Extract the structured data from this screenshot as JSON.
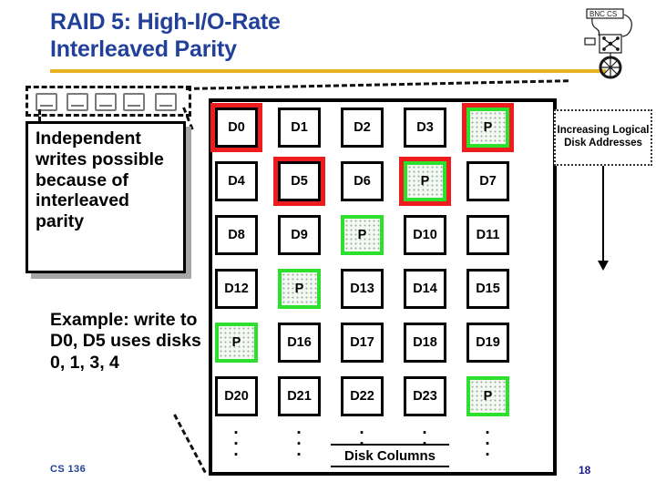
{
  "slide": {
    "title_line1": "RAID 5: High-I/O-Rate",
    "title_line2": "Interleaved Parity",
    "course": "CS 136",
    "page_number": "18",
    "title_color": "#21409A",
    "rule_color": "#E8B222",
    "highlight_red": "#EE1C1C",
    "highlight_green": "#2EE02E"
  },
  "logo": {
    "name": "bnc-cs-sketch-logo",
    "text": "BNC CS"
  },
  "callout": {
    "text": "Independent writes possible because of interleaved parity"
  },
  "example": {
    "text": "Example: write to D0, D5 uses disks 0, 1, 3, 4"
  },
  "annotation": {
    "addresses_label": "Increasing Logical Disk Addresses",
    "disk_columns_label": "Disk Columns",
    "column_ellipsis": "·"
  },
  "grid": {
    "columns": 5,
    "rows": 6,
    "cells": [
      {
        "label": "D0",
        "parity": false,
        "highlighted": true
      },
      {
        "label": "D1",
        "parity": false,
        "highlighted": false
      },
      {
        "label": "D2",
        "parity": false,
        "highlighted": false
      },
      {
        "label": "D3",
        "parity": false,
        "highlighted": false
      },
      {
        "label": "P",
        "parity": true,
        "highlighted": true
      },
      {
        "label": "D4",
        "parity": false,
        "highlighted": false
      },
      {
        "label": "D5",
        "parity": false,
        "highlighted": true
      },
      {
        "label": "D6",
        "parity": false,
        "highlighted": false
      },
      {
        "label": "P",
        "parity": true,
        "highlighted": true
      },
      {
        "label": "D7",
        "parity": false,
        "highlighted": false
      },
      {
        "label": "D8",
        "parity": false,
        "highlighted": false
      },
      {
        "label": "D9",
        "parity": false,
        "highlighted": false
      },
      {
        "label": "P",
        "parity": true,
        "highlighted": false
      },
      {
        "label": "D10",
        "parity": false,
        "highlighted": false
      },
      {
        "label": "D11",
        "parity": false,
        "highlighted": false
      },
      {
        "label": "D12",
        "parity": false,
        "highlighted": false
      },
      {
        "label": "P",
        "parity": true,
        "highlighted": false
      },
      {
        "label": "D13",
        "parity": false,
        "highlighted": false
      },
      {
        "label": "D14",
        "parity": false,
        "highlighted": false
      },
      {
        "label": "D15",
        "parity": false,
        "highlighted": false
      },
      {
        "label": "P",
        "parity": true,
        "highlighted": false
      },
      {
        "label": "D16",
        "parity": false,
        "highlighted": false
      },
      {
        "label": "D17",
        "parity": false,
        "highlighted": false
      },
      {
        "label": "D18",
        "parity": false,
        "highlighted": false
      },
      {
        "label": "D19",
        "parity": false,
        "highlighted": false
      },
      {
        "label": "D20",
        "parity": false,
        "highlighted": false
      },
      {
        "label": "D21",
        "parity": false,
        "highlighted": false
      },
      {
        "label": "D22",
        "parity": false,
        "highlighted": false
      },
      {
        "label": "D23",
        "parity": false,
        "highlighted": false
      },
      {
        "label": "P",
        "parity": true,
        "highlighted": false
      }
    ]
  }
}
